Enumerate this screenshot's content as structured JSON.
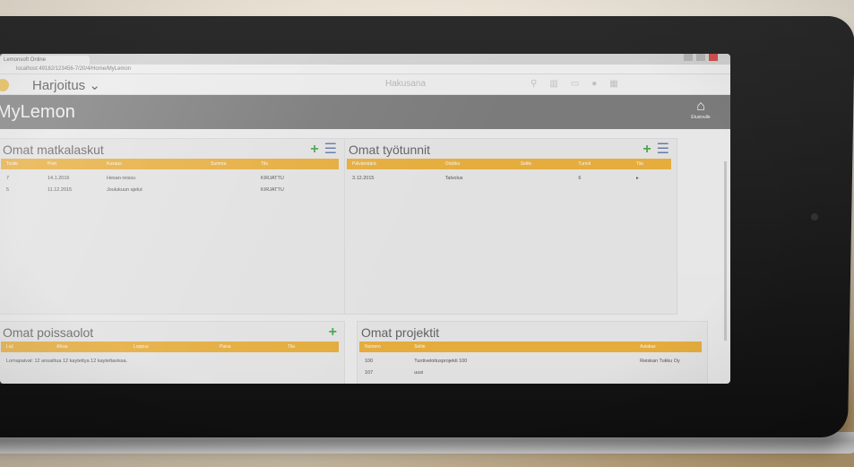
{
  "browser": {
    "tab_label": "Lemonsoft Online",
    "address": "localhost:49182/123456-7/20/4/Home/MyLemon"
  },
  "header": {
    "org_name": "Harjoitus",
    "search_placeholder": "Hakusana"
  },
  "title_bar": {
    "title": "MyLemon",
    "home_label": "Etusivulle"
  },
  "panels": {
    "matkalaskut": {
      "title": "Omat matkalaskut",
      "columns": [
        "Tosite",
        "Pvm",
        "Kuvaus",
        "Summa",
        "Tila"
      ],
      "rows": [
        [
          "7",
          "14.1.2016",
          "Hesan reissu",
          "",
          "KIRJATTU"
        ],
        [
          "5",
          "11.12.2015",
          "Joulukuun ajelut",
          "",
          "KIRJATTU"
        ]
      ]
    },
    "tyotunnit": {
      "title": "Omat työtunnit",
      "columns": [
        "Päivämäärä",
        "Otsikko",
        "Selite",
        "Tunnit",
        "Tila"
      ],
      "rows": [
        [
          "3.12.2015",
          "Talvolus",
          "",
          "6",
          "▸"
        ]
      ]
    },
    "poissaolot": {
      "title": "Omat poissaolot",
      "columns": [
        "Laji",
        "Alkaa",
        "Loppuu",
        "Paiva",
        "Tila"
      ],
      "rows": [
        [
          "Lomapaivat: 12 ansaittua 12 kaytettya 12 kaytettavissa."
        ]
      ]
    },
    "projektit": {
      "title": "Omat projektit",
      "columns": [
        "Numero",
        "Selite",
        "Asiakas"
      ],
      "rows": [
        [
          "100",
          "Tuntiveloitusprojekti 100",
          "Reiskan Tukku Oy"
        ],
        [
          "107",
          "uusi",
          ""
        ]
      ]
    }
  },
  "colors": {
    "accent_header": "#f0b540",
    "title_bar": "#808080",
    "plus": "#4caf50"
  }
}
